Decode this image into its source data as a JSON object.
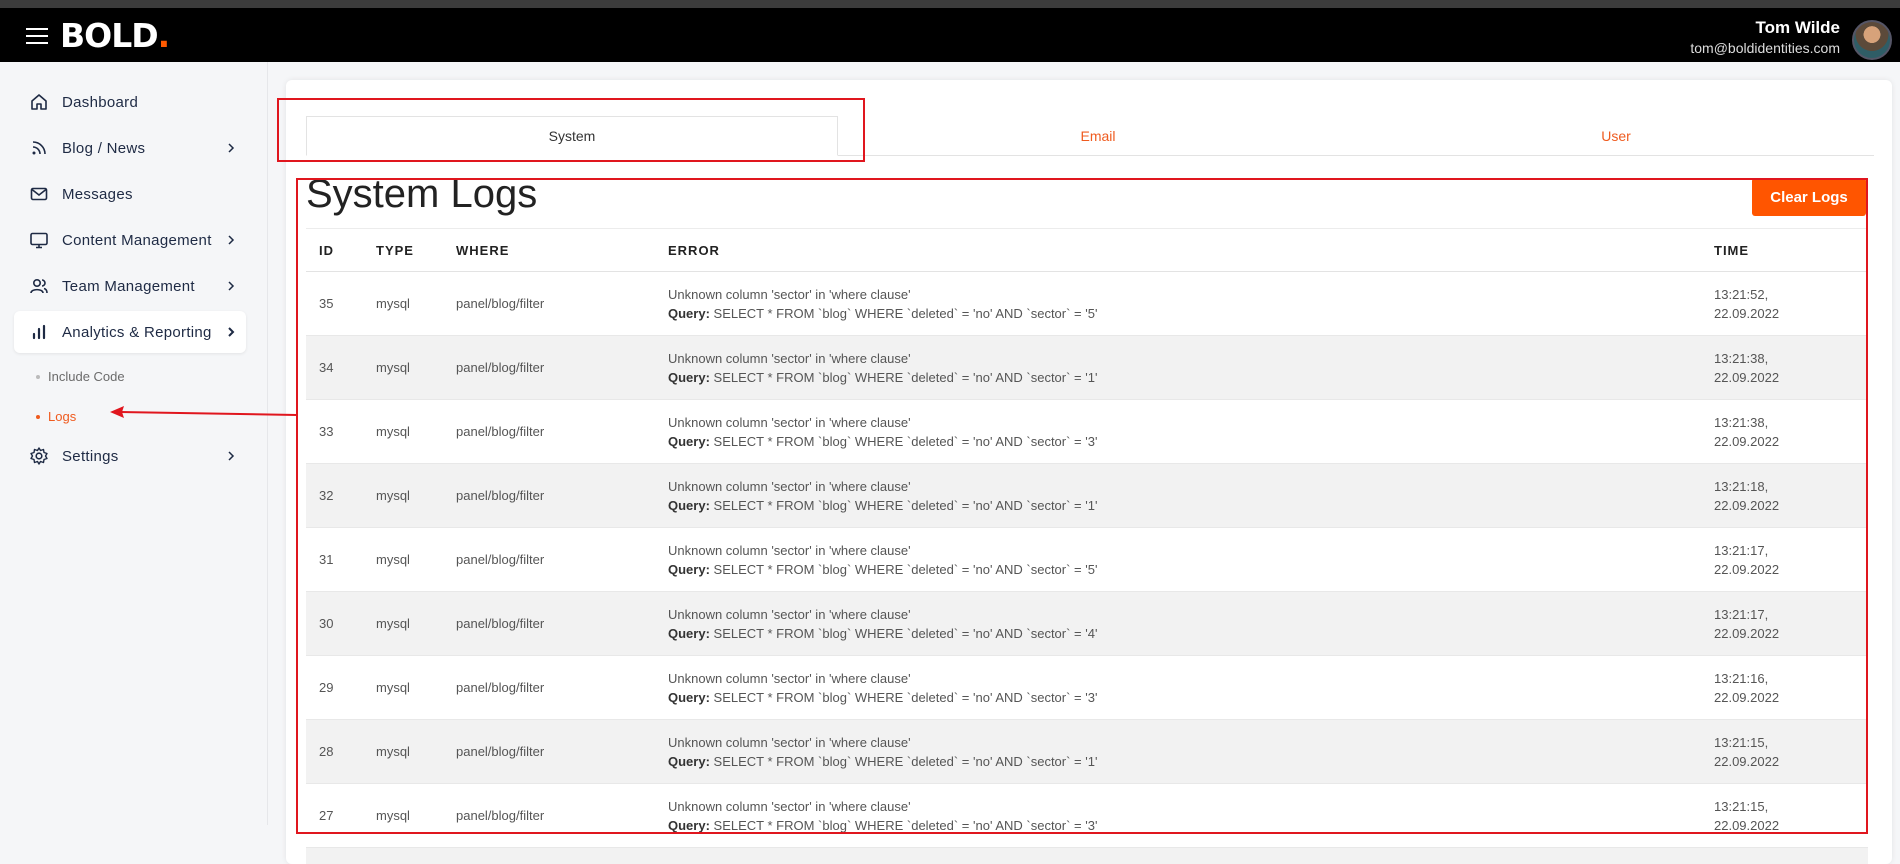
{
  "header": {
    "logo": "BOLD",
    "logo_dot": ".",
    "user_name": "Tom Wilde",
    "user_email": "tom@boldidentities.com"
  },
  "sidebar": {
    "items": [
      {
        "label": "Dashboard",
        "icon": "home-icon",
        "has_chevron": false
      },
      {
        "label": "Blog / News",
        "icon": "rss-icon",
        "has_chevron": true
      },
      {
        "label": "Messages",
        "icon": "mail-icon",
        "has_chevron": false
      },
      {
        "label": "Content Management",
        "icon": "monitor-icon",
        "has_chevron": true
      },
      {
        "label": "Team Management",
        "icon": "users-icon",
        "has_chevron": true
      },
      {
        "label": "Analytics & Reporting",
        "icon": "bar-chart-icon",
        "has_chevron": true,
        "active": true
      },
      {
        "label": "Settings",
        "icon": "gear-icon",
        "has_chevron": true
      }
    ],
    "sub_items": [
      {
        "label": "Include Code",
        "active": false
      },
      {
        "label": "Logs",
        "active": true
      }
    ]
  },
  "tabs": [
    {
      "label": "System",
      "active": true
    },
    {
      "label": "Email",
      "active": false
    },
    {
      "label": "User",
      "active": false
    }
  ],
  "main": {
    "title": "System Logs",
    "clear_button": "Clear Logs"
  },
  "table": {
    "headers": {
      "id": "ID",
      "type": "TYPE",
      "where": "WHERE",
      "error": "ERROR",
      "time": "TIME"
    },
    "query_label": "Query:",
    "rows": [
      {
        "id": "35",
        "type": "mysql",
        "where": "panel/blog/filter",
        "error": "Unknown column 'sector' in 'where clause'",
        "query": "SELECT * FROM `blog` WHERE `deleted` = 'no' AND `sector` = '5'",
        "time1": "13:21:52,",
        "time2": "22.09.2022"
      },
      {
        "id": "34",
        "type": "mysql",
        "where": "panel/blog/filter",
        "error": "Unknown column 'sector' in 'where clause'",
        "query": "SELECT * FROM `blog` WHERE `deleted` = 'no' AND `sector` = '1'",
        "time1": "13:21:38,",
        "time2": "22.09.2022"
      },
      {
        "id": "33",
        "type": "mysql",
        "where": "panel/blog/filter",
        "error": "Unknown column 'sector' in 'where clause'",
        "query": "SELECT * FROM `blog` WHERE `deleted` = 'no' AND `sector` = '3'",
        "time1": "13:21:38,",
        "time2": "22.09.2022"
      },
      {
        "id": "32",
        "type": "mysql",
        "where": "panel/blog/filter",
        "error": "Unknown column 'sector' in 'where clause'",
        "query": "SELECT * FROM `blog` WHERE `deleted` = 'no' AND `sector` = '1'",
        "time1": "13:21:18,",
        "time2": "22.09.2022"
      },
      {
        "id": "31",
        "type": "mysql",
        "where": "panel/blog/filter",
        "error": "Unknown column 'sector' in 'where clause'",
        "query": "SELECT * FROM `blog` WHERE `deleted` = 'no' AND `sector` = '5'",
        "time1": "13:21:17,",
        "time2": "22.09.2022"
      },
      {
        "id": "30",
        "type": "mysql",
        "where": "panel/blog/filter",
        "error": "Unknown column 'sector' in 'where clause'",
        "query": "SELECT * FROM `blog` WHERE `deleted` = 'no' AND `sector` = '4'",
        "time1": "13:21:17,",
        "time2": "22.09.2022"
      },
      {
        "id": "29",
        "type": "mysql",
        "where": "panel/blog/filter",
        "error": "Unknown column 'sector' in 'where clause'",
        "query": "SELECT * FROM `blog` WHERE `deleted` = 'no' AND `sector` = '3'",
        "time1": "13:21:16,",
        "time2": "22.09.2022"
      },
      {
        "id": "28",
        "type": "mysql",
        "where": "panel/blog/filter",
        "error": "Unknown column 'sector' in 'where clause'",
        "query": "SELECT * FROM `blog` WHERE `deleted` = 'no' AND `sector` = '1'",
        "time1": "13:21:15,",
        "time2": "22.09.2022"
      },
      {
        "id": "27",
        "type": "mysql",
        "where": "panel/blog/filter",
        "error": "Unknown column 'sector' in 'where clause'",
        "query": "SELECT * FROM `blog` WHERE `deleted` = 'no' AND `sector` = '3'",
        "time1": "13:21:15,",
        "time2": "22.09.2022"
      }
    ]
  },
  "colors": {
    "accent": "#ff5500",
    "annotation": "#e0161e",
    "header_bg": "#000000"
  }
}
